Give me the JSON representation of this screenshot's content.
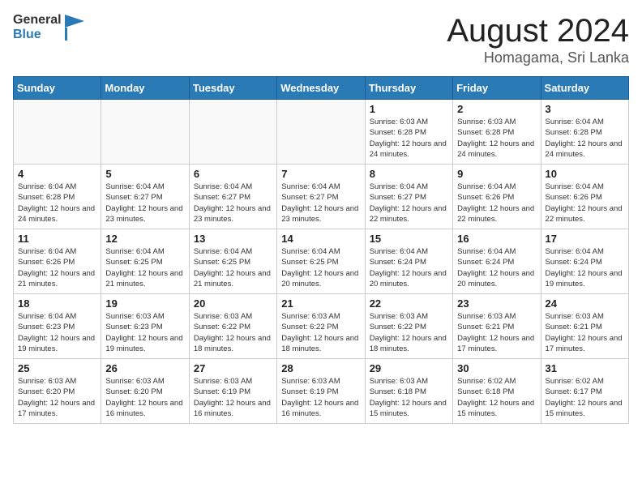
{
  "header": {
    "logo_general": "General",
    "logo_blue": "Blue",
    "month_year": "August 2024",
    "location": "Homagama, Sri Lanka"
  },
  "days_of_week": [
    "Sunday",
    "Monday",
    "Tuesday",
    "Wednesday",
    "Thursday",
    "Friday",
    "Saturday"
  ],
  "weeks": [
    [
      {
        "day": "",
        "info": ""
      },
      {
        "day": "",
        "info": ""
      },
      {
        "day": "",
        "info": ""
      },
      {
        "day": "",
        "info": ""
      },
      {
        "day": "1",
        "info": "Sunrise: 6:03 AM\nSunset: 6:28 PM\nDaylight: 12 hours and 24 minutes."
      },
      {
        "day": "2",
        "info": "Sunrise: 6:03 AM\nSunset: 6:28 PM\nDaylight: 12 hours and 24 minutes."
      },
      {
        "day": "3",
        "info": "Sunrise: 6:04 AM\nSunset: 6:28 PM\nDaylight: 12 hours and 24 minutes."
      }
    ],
    [
      {
        "day": "4",
        "info": "Sunrise: 6:04 AM\nSunset: 6:28 PM\nDaylight: 12 hours and 24 minutes."
      },
      {
        "day": "5",
        "info": "Sunrise: 6:04 AM\nSunset: 6:27 PM\nDaylight: 12 hours and 23 minutes."
      },
      {
        "day": "6",
        "info": "Sunrise: 6:04 AM\nSunset: 6:27 PM\nDaylight: 12 hours and 23 minutes."
      },
      {
        "day": "7",
        "info": "Sunrise: 6:04 AM\nSunset: 6:27 PM\nDaylight: 12 hours and 23 minutes."
      },
      {
        "day": "8",
        "info": "Sunrise: 6:04 AM\nSunset: 6:27 PM\nDaylight: 12 hours and 22 minutes."
      },
      {
        "day": "9",
        "info": "Sunrise: 6:04 AM\nSunset: 6:26 PM\nDaylight: 12 hours and 22 minutes."
      },
      {
        "day": "10",
        "info": "Sunrise: 6:04 AM\nSunset: 6:26 PM\nDaylight: 12 hours and 22 minutes."
      }
    ],
    [
      {
        "day": "11",
        "info": "Sunrise: 6:04 AM\nSunset: 6:26 PM\nDaylight: 12 hours and 21 minutes."
      },
      {
        "day": "12",
        "info": "Sunrise: 6:04 AM\nSunset: 6:25 PM\nDaylight: 12 hours and 21 minutes."
      },
      {
        "day": "13",
        "info": "Sunrise: 6:04 AM\nSunset: 6:25 PM\nDaylight: 12 hours and 21 minutes."
      },
      {
        "day": "14",
        "info": "Sunrise: 6:04 AM\nSunset: 6:25 PM\nDaylight: 12 hours and 20 minutes."
      },
      {
        "day": "15",
        "info": "Sunrise: 6:04 AM\nSunset: 6:24 PM\nDaylight: 12 hours and 20 minutes."
      },
      {
        "day": "16",
        "info": "Sunrise: 6:04 AM\nSunset: 6:24 PM\nDaylight: 12 hours and 20 minutes."
      },
      {
        "day": "17",
        "info": "Sunrise: 6:04 AM\nSunset: 6:24 PM\nDaylight: 12 hours and 19 minutes."
      }
    ],
    [
      {
        "day": "18",
        "info": "Sunrise: 6:04 AM\nSunset: 6:23 PM\nDaylight: 12 hours and 19 minutes."
      },
      {
        "day": "19",
        "info": "Sunrise: 6:03 AM\nSunset: 6:23 PM\nDaylight: 12 hours and 19 minutes."
      },
      {
        "day": "20",
        "info": "Sunrise: 6:03 AM\nSunset: 6:22 PM\nDaylight: 12 hours and 18 minutes."
      },
      {
        "day": "21",
        "info": "Sunrise: 6:03 AM\nSunset: 6:22 PM\nDaylight: 12 hours and 18 minutes."
      },
      {
        "day": "22",
        "info": "Sunrise: 6:03 AM\nSunset: 6:22 PM\nDaylight: 12 hours and 18 minutes."
      },
      {
        "day": "23",
        "info": "Sunrise: 6:03 AM\nSunset: 6:21 PM\nDaylight: 12 hours and 17 minutes."
      },
      {
        "day": "24",
        "info": "Sunrise: 6:03 AM\nSunset: 6:21 PM\nDaylight: 12 hours and 17 minutes."
      }
    ],
    [
      {
        "day": "25",
        "info": "Sunrise: 6:03 AM\nSunset: 6:20 PM\nDaylight: 12 hours and 17 minutes."
      },
      {
        "day": "26",
        "info": "Sunrise: 6:03 AM\nSunset: 6:20 PM\nDaylight: 12 hours and 16 minutes."
      },
      {
        "day": "27",
        "info": "Sunrise: 6:03 AM\nSunset: 6:19 PM\nDaylight: 12 hours and 16 minutes."
      },
      {
        "day": "28",
        "info": "Sunrise: 6:03 AM\nSunset: 6:19 PM\nDaylight: 12 hours and 16 minutes."
      },
      {
        "day": "29",
        "info": "Sunrise: 6:03 AM\nSunset: 6:18 PM\nDaylight: 12 hours and 15 minutes."
      },
      {
        "day": "30",
        "info": "Sunrise: 6:02 AM\nSunset: 6:18 PM\nDaylight: 12 hours and 15 minutes."
      },
      {
        "day": "31",
        "info": "Sunrise: 6:02 AM\nSunset: 6:17 PM\nDaylight: 12 hours and 15 minutes."
      }
    ]
  ]
}
